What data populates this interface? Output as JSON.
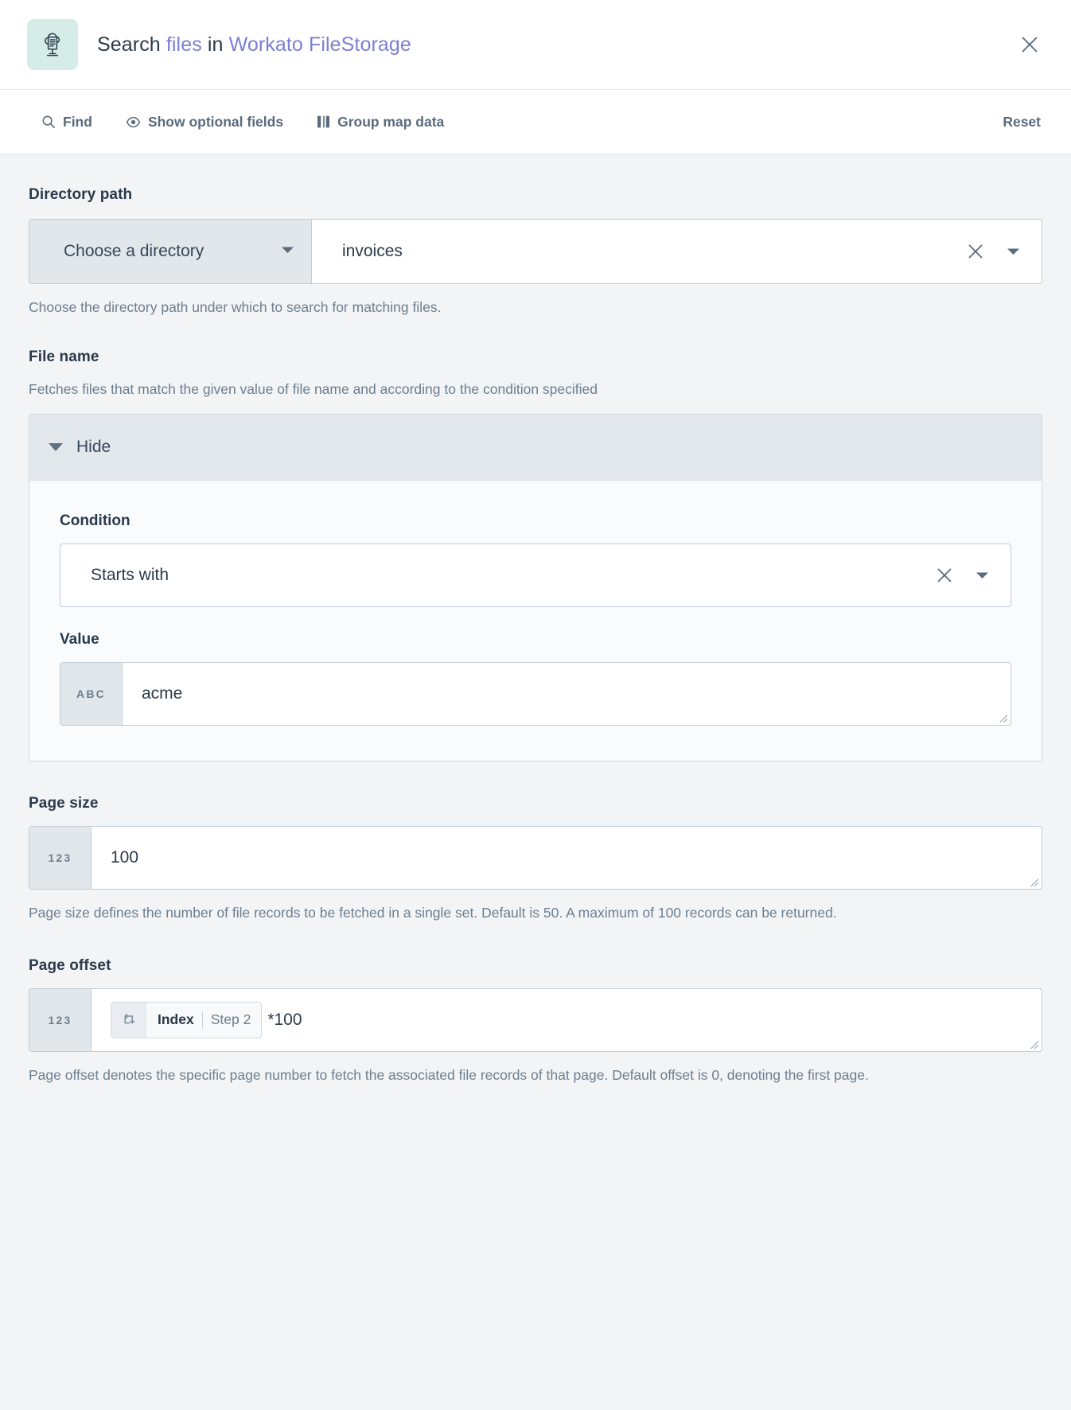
{
  "header": {
    "icon_name": "filestorage-app-icon",
    "title_prefix": "Search ",
    "title_link1": "files",
    "title_mid": " in ",
    "title_link2": "Workato FileStorage",
    "close_label": "Close"
  },
  "toolbar": {
    "find_label": "Find",
    "optional_label": "Show optional fields",
    "group_label": "Group map data",
    "reset_label": "Reset"
  },
  "directory_path": {
    "label": "Directory path",
    "select_value": "Choose a directory",
    "value": "invoices",
    "description": "Choose the directory path under which to search for matching files."
  },
  "file_name": {
    "label": "File name",
    "description": "Fetches files that match the given value of file name and according to the condition specified",
    "toggle_label": "Hide",
    "condition": {
      "label": "Condition",
      "value": "Starts with"
    },
    "value_field": {
      "label": "Value",
      "type_badge": "ABC",
      "value": "acme"
    }
  },
  "page_size": {
    "label": "Page size",
    "type_badge": "123",
    "value": "100",
    "description": "Page size defines the number of file records to be fetched in a single set. Default is 50. A maximum of 100 records can be returned."
  },
  "page_offset": {
    "label": "Page offset",
    "type_badge": "123",
    "pill": {
      "name": "Index",
      "step": "Step 2",
      "icon_name": "repeat-loop-icon"
    },
    "expression_suffix": "*100",
    "description": "Page offset denotes the specific page number to fetch the associated file records of that page. Default offset is 0, denoting the first page."
  },
  "colors": {
    "accent_link": "#7b7fd4",
    "text_primary": "#2b3a4a",
    "text_muted": "#6d7f90",
    "page_bg": "#f2f4f6",
    "app_icon_bg": "#d6ece9",
    "badge_bg": "#e2e7eb"
  }
}
